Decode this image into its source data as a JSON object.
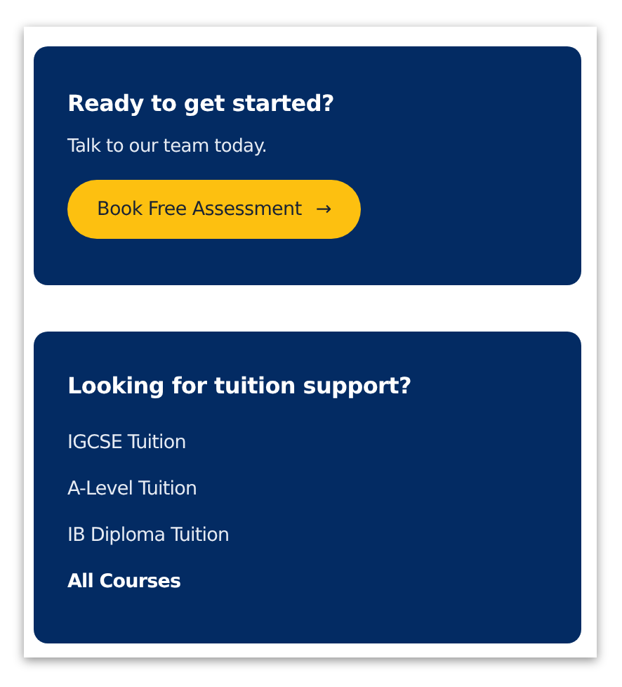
{
  "cta_card": {
    "heading": "Ready to get started?",
    "text": "Talk to our team today.",
    "button": {
      "label": "Book Free Assessment",
      "icon": "→"
    }
  },
  "links_card": {
    "heading": "Looking for tuition support?",
    "links": [
      {
        "label": "IGCSE Tuition",
        "kind": "course"
      },
      {
        "label": "A-Level Tuition",
        "kind": "course"
      },
      {
        "label": "IB Diploma Tuition",
        "kind": "course"
      },
      {
        "label": "All Courses",
        "kind": "all"
      }
    ]
  }
}
